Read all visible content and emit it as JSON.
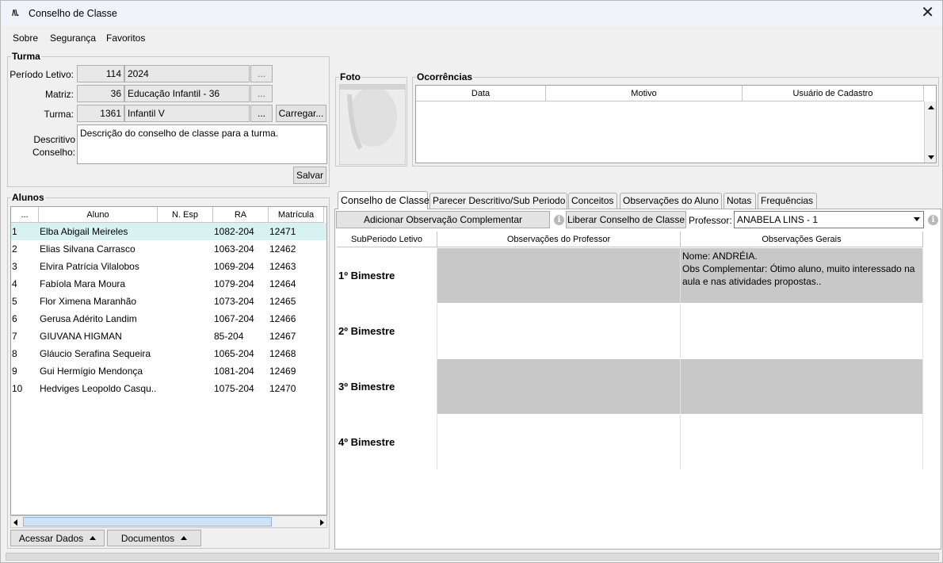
{
  "window": {
    "title": "Conselho de Classe",
    "close": "✕"
  },
  "menu": [
    "Sobre",
    "Segurança",
    "Favoritos"
  ],
  "turma": {
    "title": "Turma",
    "periodo_label": "Período Letivo:",
    "periodo_code": "114",
    "periodo_value": "2024",
    "matriz_label": "Matriz:",
    "matriz_code": "36",
    "matriz_value": "Educação Infantil - 36",
    "turma_label": "Turma:",
    "turma_code": "1361",
    "turma_value": "Infantil V",
    "ellipsis": "...",
    "carregar": "Carregar...",
    "descritivo_label1": "Descritivo",
    "descritivo_label2": "Conselho:",
    "descritivo_value": "Descrição do conselho de classe para a turma.",
    "salvar": "Salvar"
  },
  "foto": {
    "title": "Foto"
  },
  "ocorrencias": {
    "title": "Ocorrências",
    "columns": [
      "Data",
      "Motivo",
      "Usuário de Cadastro"
    ]
  },
  "alunos": {
    "title": "Alunos",
    "columns": [
      "...",
      "Aluno",
      "N. Esp",
      "RA",
      "Matrícula"
    ],
    "rows": [
      {
        "n": "1",
        "aluno": "Elba Abigail Meireles",
        "esp": "",
        "ra": "1082-204",
        "mat": "12471"
      },
      {
        "n": "2",
        "aluno": "Elias Silvana Carrasco",
        "esp": "",
        "ra": "1063-204",
        "mat": "12462"
      },
      {
        "n": "3",
        "aluno": "Elvira Patrícia Vilalobos",
        "esp": "",
        "ra": "1069-204",
        "mat": "12463"
      },
      {
        "n": "4",
        "aluno": "Fabíola Mara Moura",
        "esp": "",
        "ra": "1079-204",
        "mat": "12464"
      },
      {
        "n": "5",
        "aluno": "Flor Ximena Maranhão",
        "esp": "",
        "ra": "1073-204",
        "mat": "12465"
      },
      {
        "n": "6",
        "aluno": "Gerusa Adérito Landim",
        "esp": "",
        "ra": "1067-204",
        "mat": "12466"
      },
      {
        "n": "7",
        "aluno": "GIUVANA HIGMAN",
        "esp": "",
        "ra": "85-204",
        "mat": "12467"
      },
      {
        "n": "8",
        "aluno": "Gláucio Serafina Sequeira",
        "esp": "",
        "ra": "1065-204",
        "mat": "12468"
      },
      {
        "n": "9",
        "aluno": "Gui Hermígio Mendonça",
        "esp": "",
        "ra": "1081-204",
        "mat": "12469"
      },
      {
        "n": "10",
        "aluno": "Hedviges Leopoldo Casqu...",
        "esp": "",
        "ra": "1075-204",
        "mat": "12470"
      }
    ],
    "acessar": "Acessar Dados",
    "documentos": "Documentos"
  },
  "tabs": [
    "Conselho de Classe",
    "Parecer Descritivo/Sub Periodo",
    "Conceitos",
    "Observações do Aluno",
    "Notas",
    "Frequências"
  ],
  "toolbar": {
    "adicionar": "Adicionar Observação Complementar",
    "liberar": "Liberar Conselho de Classe",
    "professor_label": "Professor:",
    "professor_value": "ANABELA LINS - 1",
    "info": "i"
  },
  "conselho": {
    "columns": [
      "SubPeriodo Letivo",
      "Observações do Professor",
      "Observações Gerais"
    ],
    "rows": [
      {
        "periodo": "1º Bimestre",
        "prof": "",
        "geral": "Nome: ANDRÉIA.\nObs Complementar: Ótimo aluno, muito interessado na aula e nas atividades propostas.."
      },
      {
        "periodo": "2º Bimestre",
        "prof": "",
        "geral": ""
      },
      {
        "periodo": "3º Bimestre",
        "prof": "",
        "geral": ""
      },
      {
        "periodo": "4º Bimestre",
        "prof": "",
        "geral": ""
      }
    ]
  },
  "colors": {
    "selected_row": "#d8f2f2",
    "gray_row": "#c8c8c8",
    "accent": "#1e64c8"
  }
}
